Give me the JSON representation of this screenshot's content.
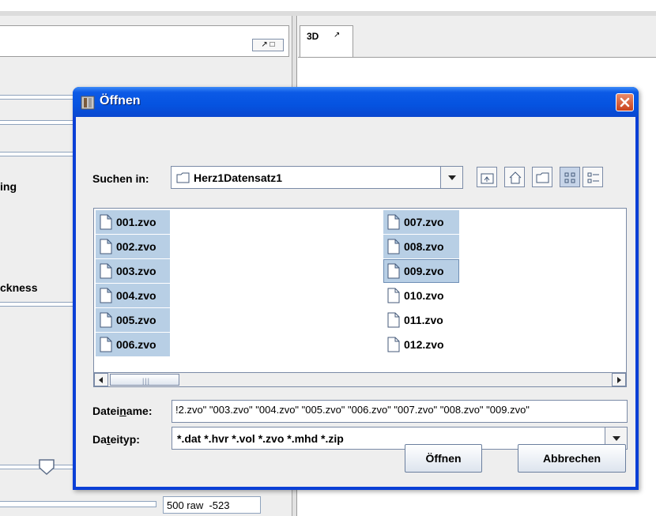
{
  "background": {
    "view_3d_tab_label": "3D",
    "labels": {
      "label_1": "ing",
      "label_2": "ckness"
    },
    "readout": "500 raw  -523"
  },
  "dialog": {
    "title": "Öffnen",
    "look_in": {
      "label": "Suchen in:",
      "value": "Herz1Datensatz1"
    },
    "toolbar": [
      "up-one-level-icon",
      "home-icon",
      "new-folder-icon",
      "list-view-icon",
      "details-view-icon"
    ],
    "files": [
      {
        "name": "001.zvo",
        "selected": true
      },
      {
        "name": "002.zvo",
        "selected": true
      },
      {
        "name": "003.zvo",
        "selected": true
      },
      {
        "name": "004.zvo",
        "selected": true
      },
      {
        "name": "005.zvo",
        "selected": true
      },
      {
        "name": "006.zvo",
        "selected": true
      },
      {
        "name": "007.zvo",
        "selected": true
      },
      {
        "name": "008.zvo",
        "selected": true
      },
      {
        "name": "009.zvo",
        "selected": true,
        "focused": true
      },
      {
        "name": "010.zvo",
        "selected": false
      },
      {
        "name": "011.zvo",
        "selected": false
      },
      {
        "name": "012.zvo",
        "selected": false
      }
    ],
    "filename": {
      "label": "Dateiname:",
      "value": "!2.zvo\" \"003.zvo\" \"004.zvo\" \"005.zvo\" \"006.zvo\" \"007.zvo\" \"008.zvo\" \"009.zvo\""
    },
    "filetype": {
      "label": "Dateityp:",
      "value": "*.dat *.hvr *.vol *.zvo *.mhd *.zip"
    },
    "buttons": {
      "open": "Öffnen",
      "cancel": "Abbrechen"
    }
  },
  "colors": {
    "title_bar": "#0553e0",
    "selection": "#b8cfe5",
    "close_button": "#c9421c"
  }
}
